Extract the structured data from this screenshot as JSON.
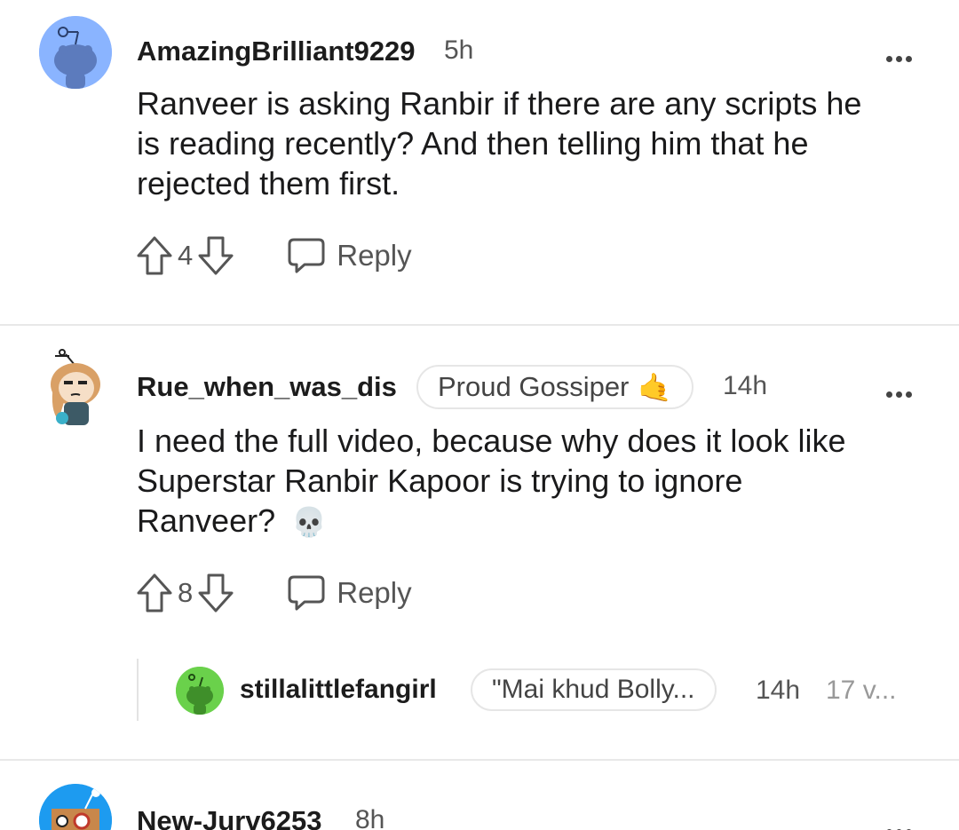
{
  "comments": [
    {
      "username": "AmazingBrilliant9229",
      "time": "5h",
      "body_lines": [
        "Ranveer is asking Ranbir if there are any scripts he",
        "is reading recently? And then telling him that he",
        "rejected them first."
      ],
      "votes": "4",
      "reply_label": "Reply",
      "avatar_color": "#8ab4ff"
    },
    {
      "username": "Rue_when_was_dis",
      "flair": "Proud Gossiper",
      "flair_emoji": "🤙",
      "time": "14h",
      "body_lines": [
        "I need the full video, because why does it look like",
        "Superstar Ranbir Kapoor is trying to ignore",
        "Ranveer?"
      ],
      "body_emoji": "💀",
      "votes": "8",
      "reply_label": "Reply"
    }
  ],
  "reply_preview": {
    "username": "stillalittlefangirl",
    "flair": "\"Mai khud Bolly...",
    "time": "14h",
    "votes_text": "17 v...",
    "avatar_color": "#6ad14b"
  },
  "next_comment": {
    "username": "New-Jurv6253",
    "time": "8h",
    "avatar_color": "#1d9bf0"
  }
}
